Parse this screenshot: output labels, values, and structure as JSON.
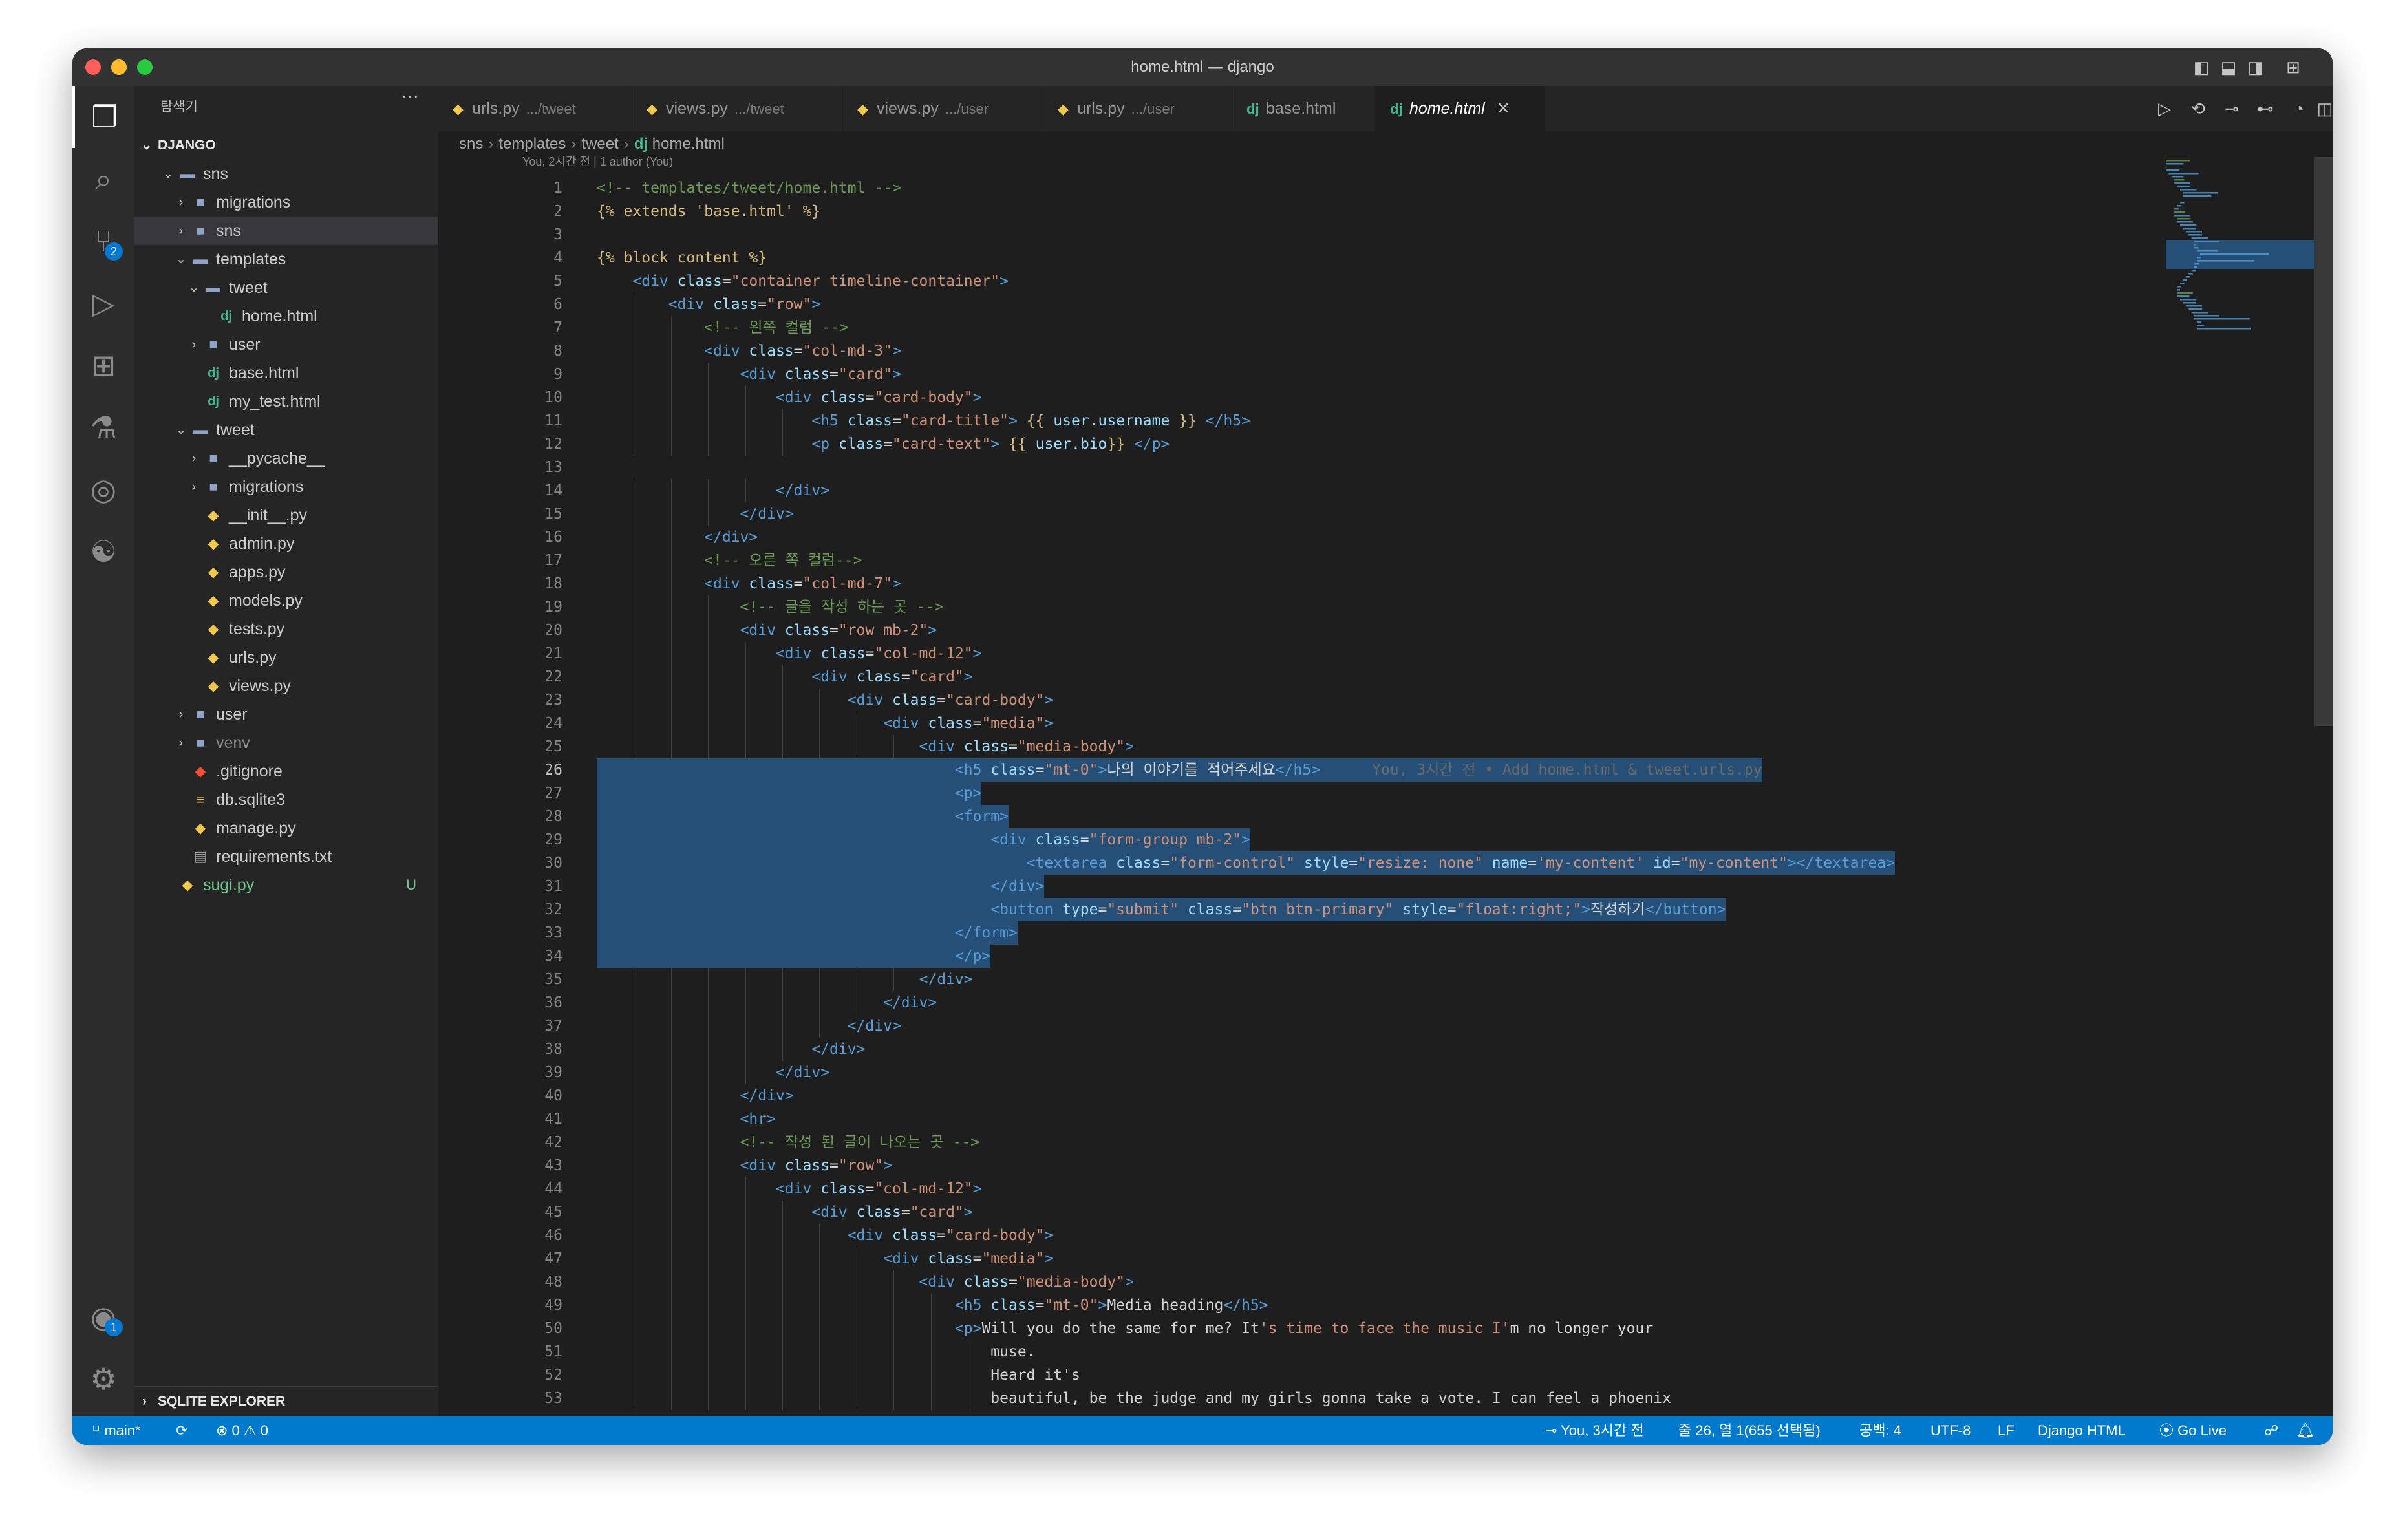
{
  "window": {
    "title": "home.html — django"
  },
  "activity": {
    "scm_badge": "2",
    "account_badge": "1"
  },
  "sidebar": {
    "header": "탐색기",
    "more": "···",
    "section": "DJANGO",
    "footer": "SQLITE EXPLORER",
    "tree": [
      {
        "label": "sns",
        "depth": 1,
        "kind": "folder-open",
        "twisty": "open"
      },
      {
        "label": "migrations",
        "depth": 2,
        "kind": "folder",
        "twisty": "closed"
      },
      {
        "label": "sns",
        "depth": 2,
        "kind": "folder",
        "twisty": "closed",
        "selected": true
      },
      {
        "label": "templates",
        "depth": 2,
        "kind": "folder-open",
        "twisty": "open"
      },
      {
        "label": "tweet",
        "depth": 3,
        "kind": "folder-open",
        "twisty": "open"
      },
      {
        "label": "home.html",
        "depth": 4,
        "kind": "django"
      },
      {
        "label": "user",
        "depth": 3,
        "kind": "folder",
        "twisty": "closed"
      },
      {
        "label": "base.html",
        "depth": 3,
        "kind": "django"
      },
      {
        "label": "my_test.html",
        "depth": 3,
        "kind": "django"
      },
      {
        "label": "tweet",
        "depth": 2,
        "kind": "folder-open",
        "twisty": "open"
      },
      {
        "label": "__pycache__",
        "depth": 3,
        "kind": "folder",
        "twisty": "closed"
      },
      {
        "label": "migrations",
        "depth": 3,
        "kind": "folder",
        "twisty": "closed"
      },
      {
        "label": "__init__.py",
        "depth": 3,
        "kind": "python"
      },
      {
        "label": "admin.py",
        "depth": 3,
        "kind": "python"
      },
      {
        "label": "apps.py",
        "depth": 3,
        "kind": "python"
      },
      {
        "label": "models.py",
        "depth": 3,
        "kind": "python"
      },
      {
        "label": "tests.py",
        "depth": 3,
        "kind": "python"
      },
      {
        "label": "urls.py",
        "depth": 3,
        "kind": "python"
      },
      {
        "label": "views.py",
        "depth": 3,
        "kind": "python"
      },
      {
        "label": "user",
        "depth": 2,
        "kind": "folder",
        "twisty": "closed"
      },
      {
        "label": "venv",
        "depth": 2,
        "kind": "folder",
        "twisty": "closed",
        "dim": true
      },
      {
        "label": ".gitignore",
        "depth": 2,
        "kind": "git"
      },
      {
        "label": "db.sqlite3",
        "depth": 2,
        "kind": "db"
      },
      {
        "label": "manage.py",
        "depth": 2,
        "kind": "python"
      },
      {
        "label": "requirements.txt",
        "depth": 2,
        "kind": "text"
      },
      {
        "label": "sugi.py",
        "depth": 1,
        "kind": "python",
        "badge": "U",
        "untracked": true
      }
    ]
  },
  "tabs": [
    {
      "name": "urls.py",
      "dir": ".../tweet",
      "kind": "python"
    },
    {
      "name": "views.py",
      "dir": ".../tweet",
      "kind": "python"
    },
    {
      "name": "views.py",
      "dir": ".../user",
      "kind": "python"
    },
    {
      "name": "urls.py",
      "dir": ".../user",
      "kind": "python"
    },
    {
      "name": "base.html",
      "dir": "",
      "kind": "django"
    },
    {
      "name": "home.html",
      "dir": "",
      "kind": "django",
      "active": true
    }
  ],
  "breadcrumb": [
    "sns",
    "templates",
    "tweet",
    "home.html"
  ],
  "blame": "You, 2시간 전 | 1 author (You)",
  "ghost_blame": "You, 3시간 전 • Add home.html & tweet.urls.py",
  "code": [
    {
      "n": "1",
      "t": "<!-- templates/tweet/home.html -->"
    },
    {
      "n": "2",
      "t": "{% extends 'base.html' %}"
    },
    {
      "n": "3",
      "t": ""
    },
    {
      "n": "4",
      "t": "{% block content %}"
    },
    {
      "n": "5",
      "t": "    <div class=\"container timeline-container\">"
    },
    {
      "n": "6",
      "t": "        <div class=\"row\">"
    },
    {
      "n": "7",
      "t": "            <!-- 왼쪽 컬럼 -->"
    },
    {
      "n": "8",
      "t": "            <div class=\"col-md-3\">"
    },
    {
      "n": "9",
      "t": "                <div class=\"card\">"
    },
    {
      "n": "10",
      "t": "                    <div class=\"card-body\">"
    },
    {
      "n": "11",
      "t": "                        <h5 class=\"card-title\"> {{ user.username }} </h5>"
    },
    {
      "n": "12",
      "t": "                        <p class=\"card-text\"> {{ user.bio}} </p>"
    },
    {
      "n": "13",
      "t": ""
    },
    {
      "n": "14",
      "t": "                    </div>"
    },
    {
      "n": "15",
      "t": "                </div>"
    },
    {
      "n": "16",
      "t": "            </div>"
    },
    {
      "n": "17",
      "t": "            <!-- 오른 쪽 컬럼-->"
    },
    {
      "n": "18",
      "t": "            <div class=\"col-md-7\">"
    },
    {
      "n": "19",
      "t": "                <!-- 글을 작성 하는 곳 -->"
    },
    {
      "n": "20",
      "t": "                <div class=\"row mb-2\">"
    },
    {
      "n": "21",
      "t": "                    <div class=\"col-md-12\">"
    },
    {
      "n": "22",
      "t": "                        <div class=\"card\">"
    },
    {
      "n": "23",
      "t": "                            <div class=\"card-body\">"
    },
    {
      "n": "24",
      "t": "                                <div class=\"media\">"
    },
    {
      "n": "25",
      "t": "                                    <div class=\"media-body\">"
    },
    {
      "n": "26",
      "t": "                                        <h5 class=\"mt-0\">나의 이야기를 적어주세요</h5>",
      "hl": true,
      "current": true,
      "ghost": true
    },
    {
      "n": "27",
      "t": "                                        <p>",
      "hl": true
    },
    {
      "n": "28",
      "t": "                                        <form>",
      "hl": true
    },
    {
      "n": "29",
      "t": "                                            <div class=\"form-group mb-2\">",
      "hl": true
    },
    {
      "n": "30",
      "t": "                                                <textarea class=\"form-control\" style=\"resize: none\" name='my-content' id=\"my-content\"></textarea>",
      "hl": true
    },
    {
      "n": "31",
      "t": "                                            </div>",
      "hl": true
    },
    {
      "n": "32",
      "t": "                                            <button type=\"submit\" class=\"btn btn-primary\" style=\"float:right;\">작성하기</button>",
      "hl": true
    },
    {
      "n": "33",
      "t": "                                        </form>",
      "hl": true
    },
    {
      "n": "34",
      "t": "                                        </p>",
      "hl": true
    },
    {
      "n": "35",
      "t": "                                    </div>"
    },
    {
      "n": "36",
      "t": "                                </div>"
    },
    {
      "n": "37",
      "t": "                            </div>"
    },
    {
      "n": "38",
      "t": "                        </div>"
    },
    {
      "n": "39",
      "t": "                    </div>"
    },
    {
      "n": "40",
      "t": "                </div>"
    },
    {
      "n": "41",
      "t": "                <hr>"
    },
    {
      "n": "42",
      "t": "                <!-- 작성 된 글이 나오는 곳 -->"
    },
    {
      "n": "43",
      "t": "                <div class=\"row\">"
    },
    {
      "n": "44",
      "t": "                    <div class=\"col-md-12\">"
    },
    {
      "n": "45",
      "t": "                        <div class=\"card\">"
    },
    {
      "n": "46",
      "t": "                            <div class=\"card-body\">"
    },
    {
      "n": "47",
      "t": "                                <div class=\"media\">"
    },
    {
      "n": "48",
      "t": "                                    <div class=\"media-body\">"
    },
    {
      "n": "49",
      "t": "                                        <h5 class=\"mt-0\">Media heading</h5>"
    },
    {
      "n": "50",
      "t": "                                        <p>Will you do the same for me? It's time to face the music I'm no longer your"
    },
    {
      "n": "51",
      "t": "                                            muse."
    },
    {
      "n": "52",
      "t": "                                            Heard it's"
    },
    {
      "n": "53",
      "t": "                                            beautiful, be the judge and my girls gonna take a vote. I can feel a phoenix"
    }
  ],
  "status": {
    "branch": "main*",
    "errors": "0",
    "warnings": "0",
    "blame": "You, 3시간 전",
    "position": "줄 26, 열 1(655 선택됨)",
    "spaces": "공백: 4",
    "encoding": "UTF-8",
    "eol": "LF",
    "language": "Django HTML",
    "golive": "Go Live"
  },
  "colors": {
    "accent": "#007acc",
    "selection": "#264f78",
    "background": "#1e1e1e",
    "sidebar": "#252526"
  }
}
